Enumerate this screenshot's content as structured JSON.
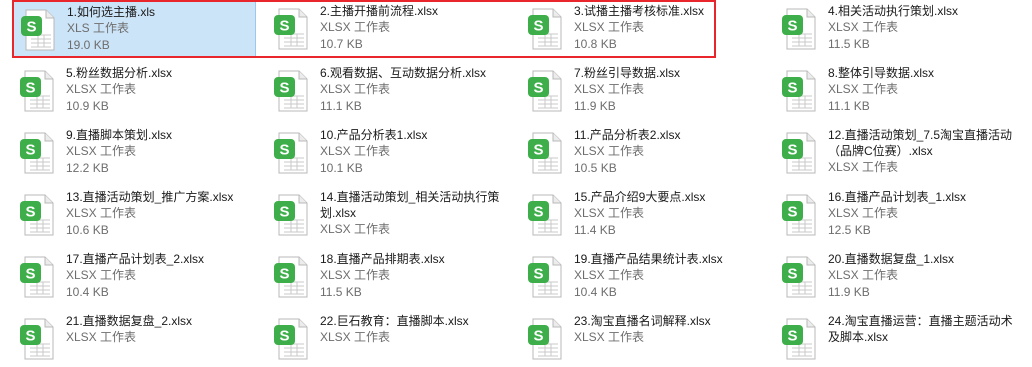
{
  "files": [
    {
      "name": "1.如何选主播.xls",
      "type": "XLS 工作表",
      "size": "19.0 KB",
      "selected": true
    },
    {
      "name": "2.主播开播前流程.xlsx",
      "type": "XLSX 工作表",
      "size": "10.7 KB"
    },
    {
      "name": "3.试播主播考核标准.xlsx",
      "type": "XLSX 工作表",
      "size": "10.8 KB"
    },
    {
      "name": "4.相关活动执行策划.xlsx",
      "type": "XLSX 工作表",
      "size": "11.5 KB"
    },
    {
      "name": "5.粉丝数据分析.xlsx",
      "type": "XLSX 工作表",
      "size": "10.9 KB"
    },
    {
      "name": "6.观看数据、互动数据分析.xlsx",
      "type": "XLSX 工作表",
      "size": "11.1 KB"
    },
    {
      "name": "7.粉丝引导数据.xlsx",
      "type": "XLSX 工作表",
      "size": "11.9 KB"
    },
    {
      "name": "8.整体引导数据.xlsx",
      "type": "XLSX 工作表",
      "size": "11.1 KB"
    },
    {
      "name": "9.直播脚本策划.xlsx",
      "type": "XLSX 工作表",
      "size": "12.2 KB"
    },
    {
      "name": "10.产品分析表1.xlsx",
      "type": "XLSX 工作表",
      "size": "10.1 KB"
    },
    {
      "name": "11.产品分析表2.xlsx",
      "type": "XLSX 工作表",
      "size": "10.5 KB"
    },
    {
      "name": "12.直播活动策划_7.5淘宝直播活动（品牌C位赛）.xlsx",
      "type": "XLSX 工作表",
      "size": ""
    },
    {
      "name": "13.直播活动策划_推广方案.xlsx",
      "type": "XLSX 工作表",
      "size": "10.6 KB"
    },
    {
      "name": "14.直播活动策划_相关活动执行策划.xlsx",
      "type": "XLSX 工作表",
      "size": ""
    },
    {
      "name": "15.产品介绍9大要点.xlsx",
      "type": "XLSX 工作表",
      "size": "11.4 KB"
    },
    {
      "name": "16.直播产品计划表_1.xlsx",
      "type": "XLSX 工作表",
      "size": "12.5 KB"
    },
    {
      "name": "17.直播产品计划表_2.xlsx",
      "type": "XLSX 工作表",
      "size": "10.4 KB"
    },
    {
      "name": "18.直播产品排期表.xlsx",
      "type": "XLSX 工作表",
      "size": "11.5 KB"
    },
    {
      "name": "19.直播产品结果统计表.xlsx",
      "type": "XLSX 工作表",
      "size": "10.4 KB"
    },
    {
      "name": "20.直播数据复盘_1.xlsx",
      "type": "XLSX 工作表",
      "size": "11.9 KB"
    },
    {
      "name": "21.直播数据复盘_2.xlsx",
      "type": "XLSX 工作表",
      "size": ""
    },
    {
      "name": "22.巨石教育：直播脚本.xlsx",
      "type": "XLSX 工作表",
      "size": ""
    },
    {
      "name": "23.淘宝直播名词解释.xlsx",
      "type": "XLSX 工作表",
      "size": ""
    },
    {
      "name": "24.淘宝直播运营：直播主题活动术及脚本.xlsx",
      "type": "",
      "size": ""
    }
  ],
  "colors": {
    "icon_green": "#3eae4a",
    "highlight_border": "#e8262c",
    "selection_bg": "#cce4f7"
  },
  "icon": "excel-spreadsheet-icon"
}
